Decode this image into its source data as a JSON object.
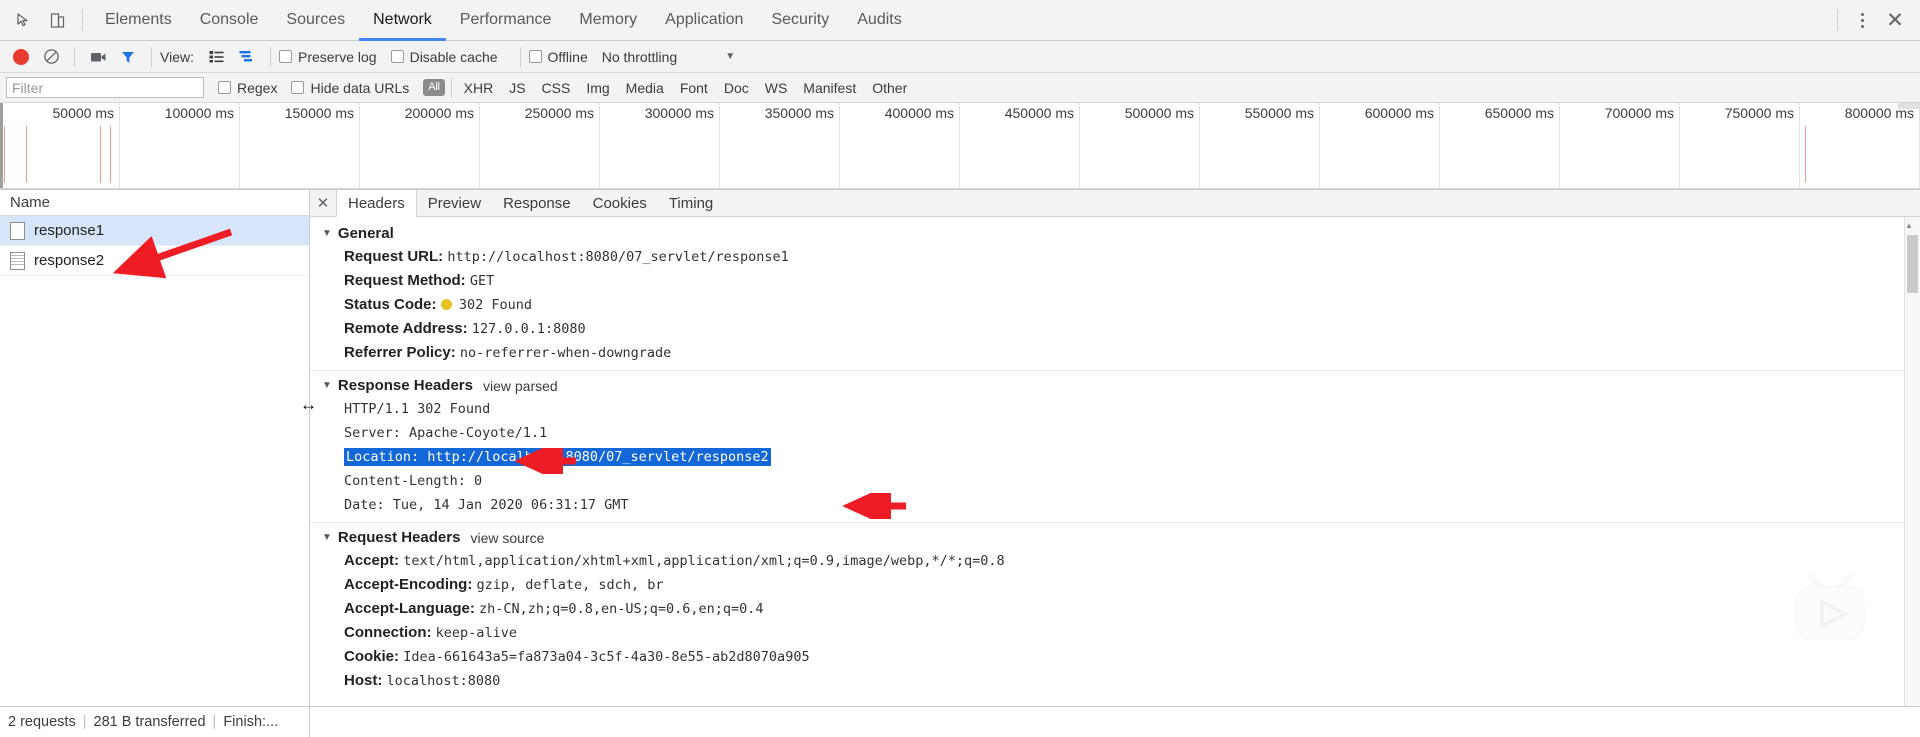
{
  "window": {
    "top_tabs": [
      {
        "label": "Elements",
        "active": false
      },
      {
        "label": "Console",
        "active": false
      },
      {
        "label": "Sources",
        "active": false
      },
      {
        "label": "Network",
        "active": true
      },
      {
        "label": "Performance",
        "active": false
      },
      {
        "label": "Memory",
        "active": false
      },
      {
        "label": "Application",
        "active": false
      },
      {
        "label": "Security",
        "active": false
      },
      {
        "label": "Audits",
        "active": false
      }
    ],
    "inspect_icon": "inspect-element-icon",
    "device_icon": "device-toolbar-icon",
    "more_icon": "kebab-menu-icon",
    "close_icon": "close-icon"
  },
  "toolbar": {
    "record_icon": "record-button-icon",
    "clear_icon": "clear-icon",
    "camera_icon": "screenshot-camera-icon",
    "filter_icon": "filter-funnel-icon",
    "view_label": "View:",
    "view_list_icon": "list-view-icon",
    "view_waterfall_icon": "waterfall-view-icon",
    "preserve_log": "Preserve log",
    "disable_cache": "Disable cache",
    "offline": "Offline",
    "throttling": "No throttling",
    "throttle_caret": "▼"
  },
  "filterbar": {
    "placeholder": "Filter",
    "value": "",
    "regex": "Regex",
    "hide_data_urls": "Hide data URLs",
    "types": [
      "All",
      "XHR",
      "JS",
      "CSS",
      "Img",
      "Media",
      "Font",
      "Doc",
      "WS",
      "Manifest",
      "Other"
    ],
    "active_type": "All"
  },
  "overview": {
    "ticks": [
      "50000 ms",
      "100000 ms",
      "150000 ms",
      "200000 ms",
      "250000 ms",
      "300000 ms",
      "350000 ms",
      "400000 ms",
      "450000 ms",
      "500000 ms",
      "550000 ms",
      "600000 ms",
      "650000 ms",
      "700000 ms",
      "750000 ms",
      "800000 ms"
    ],
    "event_line_color": "#eb9a9a"
  },
  "requests": {
    "column_header": "Name",
    "rows": [
      {
        "name": "response1",
        "selected": true,
        "icon": "blank-document-icon"
      },
      {
        "name": "response2",
        "selected": false,
        "icon": "text-document-icon"
      }
    ]
  },
  "detail": {
    "close_icon": "close-panel-icon",
    "tabs": [
      {
        "label": "Headers",
        "active": true
      },
      {
        "label": "Preview",
        "active": false
      },
      {
        "label": "Response",
        "active": false
      },
      {
        "label": "Cookies",
        "active": false
      },
      {
        "label": "Timing",
        "active": false
      }
    ],
    "general": {
      "title": "General",
      "triangle": "▼",
      "rows": [
        {
          "key": "Request URL:",
          "value": "http://localhost:8080/07_servlet/response1"
        },
        {
          "key": "Request Method:",
          "value": "GET"
        },
        {
          "key": "Status Code:",
          "value": "302 Found",
          "status_dot": "#e8c222"
        },
        {
          "key": "Remote Address:",
          "value": "127.0.0.1:8080"
        },
        {
          "key": "Referrer Policy:",
          "value": "no-referrer-when-downgrade"
        }
      ]
    },
    "response_headers": {
      "title": "Response Headers",
      "triangle": "▼",
      "view_link": "view parsed",
      "lines": [
        {
          "text": "HTTP/1.1 302 Found",
          "highlighted": false
        },
        {
          "text": "Server: Apache-Coyote/1.1",
          "highlighted": false
        },
        {
          "text": "Location: http://localhost:8080/07_servlet/response2",
          "highlighted": true
        },
        {
          "text": "Content-Length: 0",
          "highlighted": false
        },
        {
          "text": "Date: Tue, 14 Jan 2020 06:31:17 GMT",
          "highlighted": false
        }
      ]
    },
    "request_headers": {
      "title": "Request Headers",
      "triangle": "▼",
      "view_link": "view source",
      "rows": [
        {
          "key": "Accept:",
          "value": "text/html,application/xhtml+xml,application/xml;q=0.9,image/webp,*/*;q=0.8"
        },
        {
          "key": "Accept-Encoding:",
          "value": "gzip, deflate, sdch, br"
        },
        {
          "key": "Accept-Language:",
          "value": "zh-CN,zh;q=0.8,en-US;q=0.6,en;q=0.4"
        },
        {
          "key": "Connection:",
          "value": "keep-alive"
        },
        {
          "key": "Cookie:",
          "value": "Idea-661643a5=fa873a04-3c5f-4a30-8e55-ab2d8070a905"
        },
        {
          "key": "Host:",
          "value": "localhost:8080"
        }
      ]
    }
  },
  "statusbar": {
    "requests": "2 requests",
    "transferred": "281 B transferred",
    "finish": "Finish:...",
    "sep": "|"
  },
  "annotations": {
    "arrow_color": "#ee1c25",
    "arrow_to_response1": "arrow-pointing-to-response1",
    "arrow_to_status_line": "arrow-pointing-to-http-status-line",
    "arrow_to_location": "arrow-pointing-to-location-header",
    "resize_handle": "↔"
  },
  "watermark": {
    "name": "bilibili-tv-logo-watermark"
  }
}
